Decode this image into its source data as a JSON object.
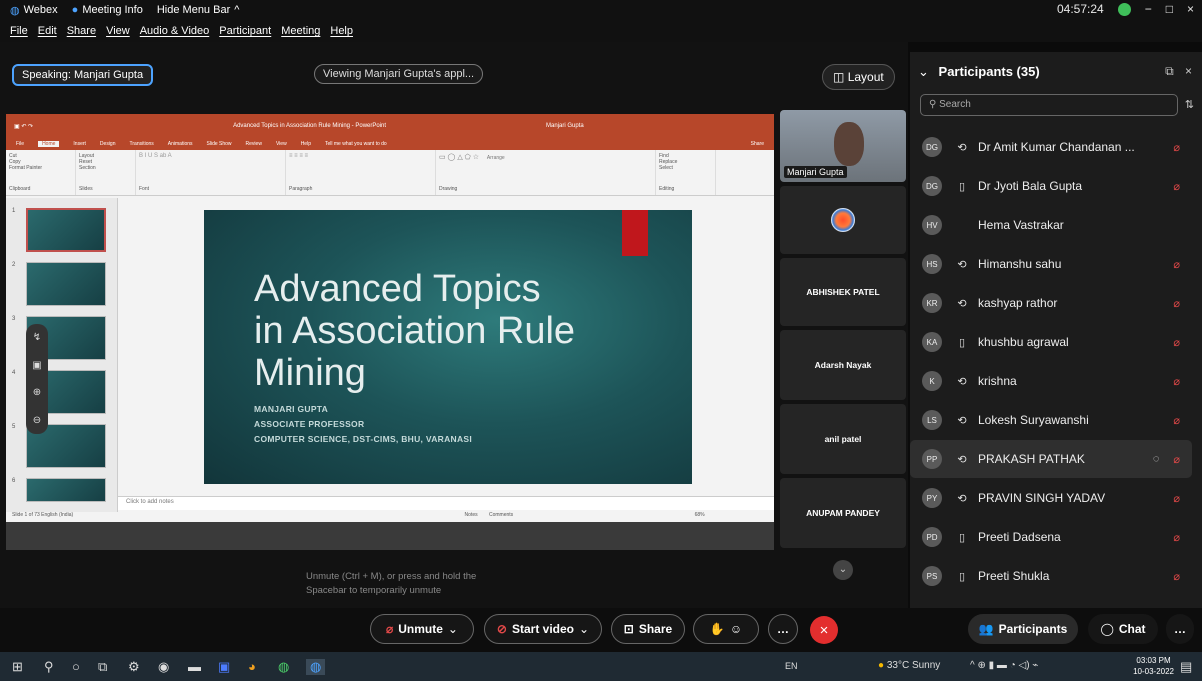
{
  "titlebar": {
    "app": "Webex",
    "meeting_info": "Meeting Info",
    "hide_menu": "Hide Menu Bar",
    "chevron": "^",
    "time": "04:57:24",
    "win_min": "−",
    "win_max": "□",
    "win_close": "×"
  },
  "menu": {
    "items": [
      "File",
      "Edit",
      "Share",
      "View",
      "Audio & Video",
      "Participant",
      "Meeting",
      "Help"
    ]
  },
  "stage": {
    "speaking_label": "Speaking: Manjari Gupta",
    "viewing_label": "Viewing Manjari Gupta's appl...",
    "layout_label": "Layout"
  },
  "ppt": {
    "window_title": "Advanced Topics in Association Rule Mining - PowerPoint",
    "user": "Manjari Gupta",
    "tabs": [
      "File",
      "Home",
      "Insert",
      "Design",
      "Transitions",
      "Animations",
      "Slide Show",
      "Review",
      "View",
      "Help",
      "Tell me what you want to do",
      "Share"
    ],
    "ribbon_groups": [
      "Clipboard",
      "Slides",
      "Font",
      "Paragraph",
      "Drawing",
      "Editing"
    ],
    "ribbon_items": {
      "cut": "Cut",
      "copy": "Copy",
      "format_painter": "Format Painter",
      "paste": "Paste",
      "new_slide": "New Slide",
      "layout": "Layout",
      "reset": "Reset",
      "section": "Section",
      "arrange": "Arrange",
      "find": "Find",
      "replace": "Replace",
      "select": "Select"
    },
    "slide": {
      "title_line1": "Advanced Topics",
      "title_line2": "in Association Rule",
      "title_line3": "Mining",
      "author": "MANJARI GUPTA",
      "position": "ASSOCIATE PROFESSOR",
      "affiliation": "COMPUTER SCIENCE, DST-CIMS, BHU, VARANASI"
    },
    "thumb_numbers": [
      "1",
      "2",
      "3",
      "4",
      "5",
      "6"
    ],
    "notes_placeholder": "Click to add notes",
    "status_left": "Slide 1 of 73   English (India)",
    "status_notes": "Notes",
    "status_comments": "Comments",
    "zoom": "68%"
  },
  "videos": {
    "presenter_name": "Manjari Gupta",
    "tiles": [
      "ABHISHEK PATEL",
      "Adarsh Nayak",
      "anil patel",
      "ANUPAM PANDEY"
    ]
  },
  "unmute_tip": {
    "line1": "Unmute (Ctrl + M), or press and hold the",
    "line2": "Spacebar to temporarily unmute"
  },
  "participants": {
    "title": "Participants (35)",
    "search_placeholder": "Search",
    "list": [
      {
        "initials": "DG",
        "name": "Dr Amit Kumar Chandanan ...",
        "device": "phone",
        "muted": true
      },
      {
        "initials": "DG",
        "name": "Dr Jyoti Bala Gupta",
        "device": "mobile",
        "muted": true
      },
      {
        "initials": "HV",
        "name": "Hema Vastrakar",
        "device": "none",
        "muted": false
      },
      {
        "initials": "HS",
        "name": "Himanshu sahu",
        "device": "phone",
        "muted": true
      },
      {
        "initials": "KR",
        "name": "kashyap rathor",
        "device": "phone",
        "muted": true
      },
      {
        "initials": "KA",
        "name": "khushbu agrawal",
        "device": "mobile",
        "muted": true
      },
      {
        "initials": "K",
        "name": "krishna",
        "device": "phone",
        "muted": true
      },
      {
        "initials": "LS",
        "name": "Lokesh Suryawanshi",
        "device": "phone",
        "muted": true
      },
      {
        "initials": "PP",
        "name": "PRAKASH PATHAK",
        "device": "phone",
        "muted": true
      },
      {
        "initials": "PY",
        "name": "PRAVIN SINGH YADAV",
        "device": "phone",
        "muted": true
      },
      {
        "initials": "PD",
        "name": "Preeti Dadsena",
        "device": "mobile",
        "muted": true
      },
      {
        "initials": "PS",
        "name": "Preeti Shukla",
        "device": "mobile",
        "muted": true
      }
    ]
  },
  "controls": {
    "unmute": "Unmute",
    "start_video": "Start video",
    "share": "Share",
    "participants": "Participants",
    "chat": "Chat",
    "more": "…"
  },
  "taskbar": {
    "lang": "EN",
    "weather": "33°C Sunny",
    "time": "03:03 PM",
    "date": "10-03-2022"
  },
  "colors": {
    "accent_blue": "#4da3ff",
    "mute_red": "#e04848",
    "leave_red": "#e32e2e",
    "ppt_orange": "#b7472a",
    "slide_teal": "#1d5458"
  }
}
